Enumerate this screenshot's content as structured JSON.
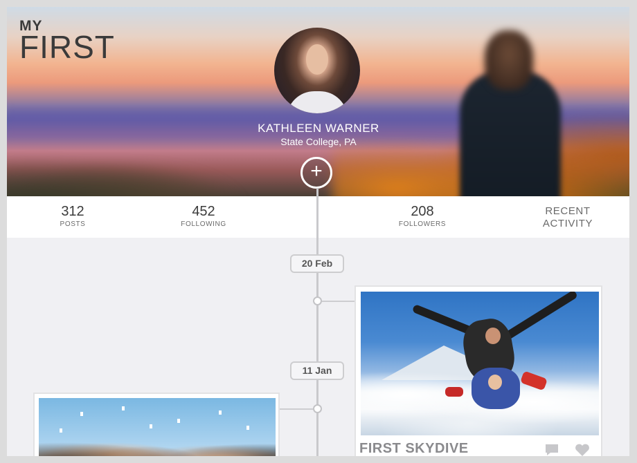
{
  "app": {
    "logo_top": "MY",
    "logo_bottom": "FIRST"
  },
  "profile": {
    "name": "KATHLEEN WARNER",
    "location": "State College, PA",
    "add_symbol": "+"
  },
  "stats": {
    "posts": {
      "value": "312",
      "label": "POSTS"
    },
    "following": {
      "value": "452",
      "label": "FOLLOWING"
    },
    "followers": {
      "value": "208",
      "label": "FOLLOWERS"
    },
    "recent_line1": "RECENT",
    "recent_line2": "ACTIVITY"
  },
  "timeline": {
    "dates": [
      "20 Feb",
      "11 Jan"
    ],
    "posts": [
      {
        "title": "FIRST SKYDIVE",
        "comment_icon": "speech-bubble-icon",
        "like_icon": "heart-icon"
      }
    ]
  },
  "colors": {
    "accent_text": "#8a8a8d",
    "timeline_line": "#c9c9cc",
    "background": "#f0f0f3"
  }
}
